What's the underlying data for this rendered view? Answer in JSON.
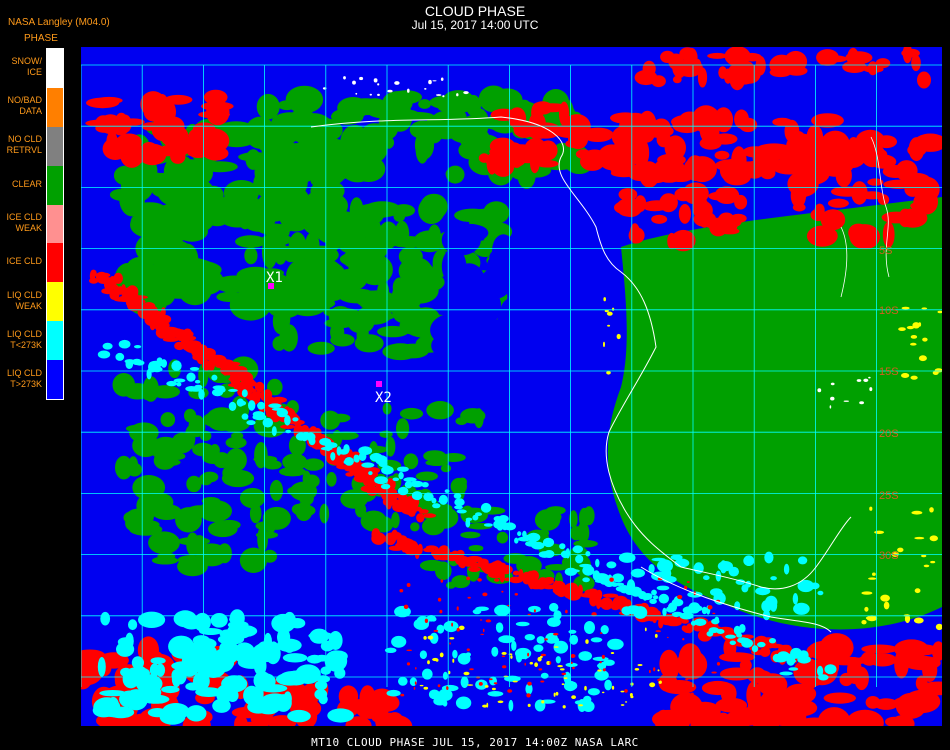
{
  "header": {
    "source": "NASA Langley (M04.0)",
    "phase_label": "PHASE",
    "title": "CLOUD PHASE",
    "subtitle": "Jul 15, 2017 14:00 UTC"
  },
  "legend": [
    {
      "line1": "SNOW/",
      "line2": "ICE",
      "color": "#ffffff"
    },
    {
      "line1": "NO/BAD",
      "line2": "DATA",
      "color": "#ff7f00"
    },
    {
      "line1": "NO CLD",
      "line2": "RETRVL",
      "color": "#808080"
    },
    {
      "line1": "CLEAR",
      "line2": "",
      "color": "#00a000"
    },
    {
      "line1": "ICE CLD",
      "line2": "WEAK",
      "color": "#ff9090"
    },
    {
      "line1": "ICE CLD",
      "line2": "",
      "color": "#ff0000"
    },
    {
      "line1": "LIQ CLD",
      "line2": "WEAK",
      "color": "#ffff00"
    },
    {
      "line1": "LIQ CLD",
      "line2": "T<273K",
      "color": "#00ffff"
    },
    {
      "line1": "LIQ CLD",
      "line2": "T>273K",
      "color": "#0000ff"
    }
  ],
  "markers": [
    {
      "label": "X1",
      "color": "#ff00ff"
    },
    {
      "label": "X2",
      "color": "#ff00ff"
    }
  ],
  "lat_labels": [
    "5S",
    "10S",
    "15S",
    "20S",
    "25S",
    "30S"
  ],
  "grid_color": "#00ffff",
  "footer": "MT10  CLOUD PHASE   JUL 15, 2017 14:00Z   NASA LARC"
}
